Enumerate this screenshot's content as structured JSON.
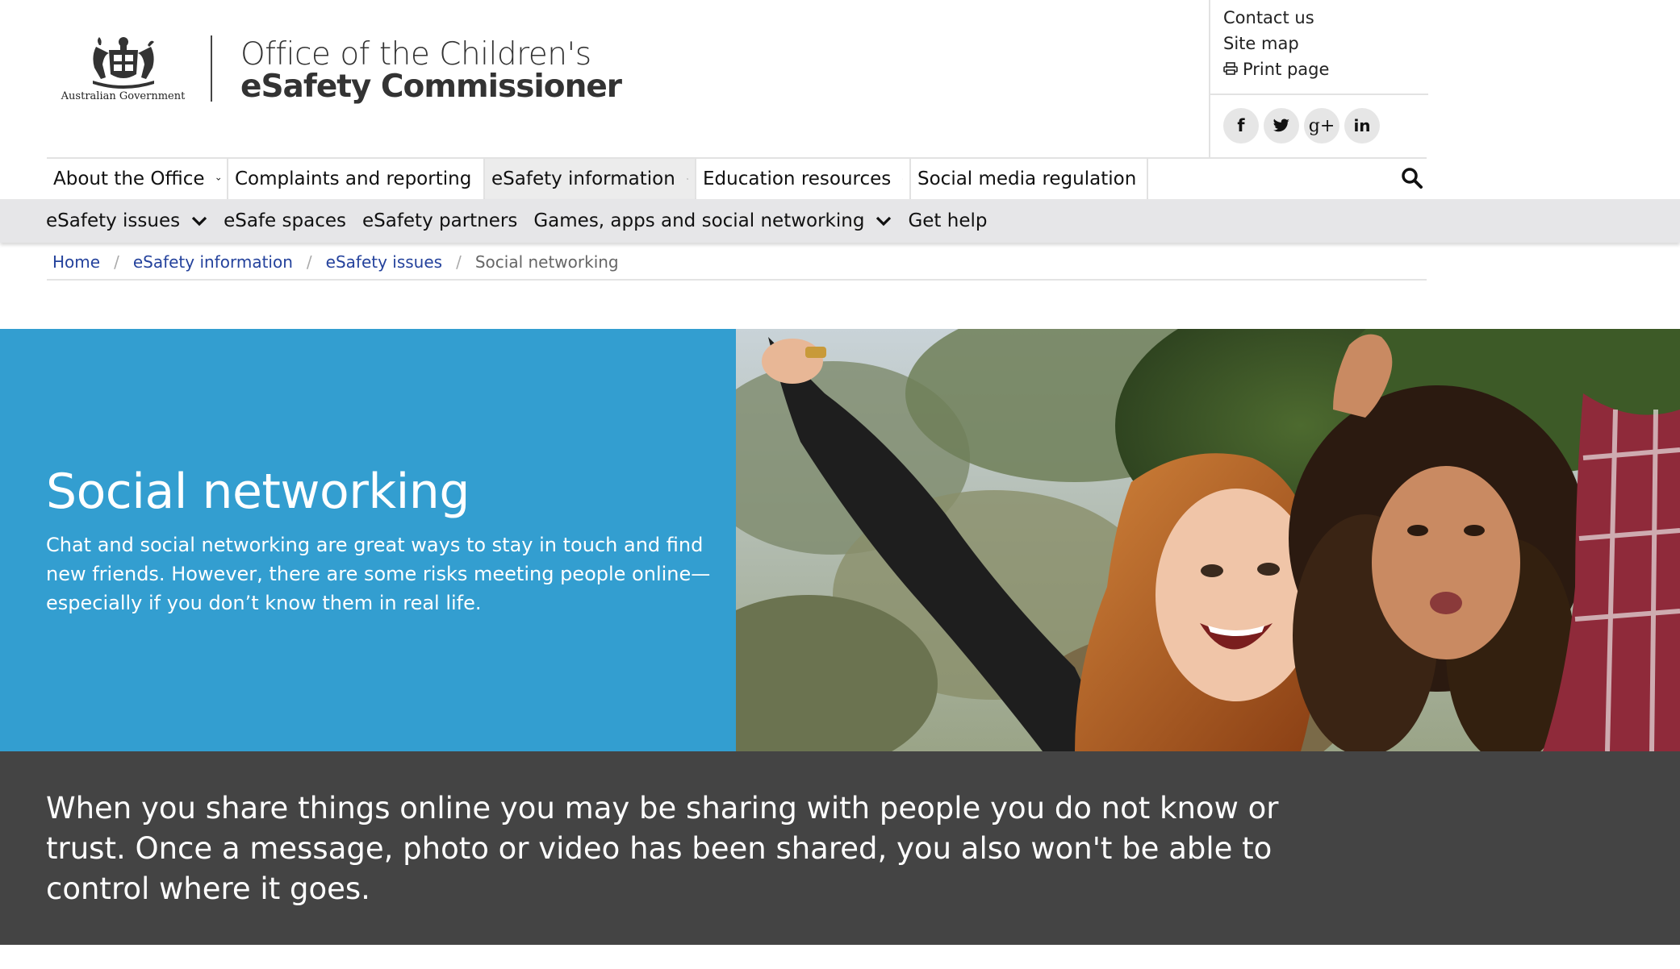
{
  "header": {
    "gov_label": "Australian Government",
    "org_line1": "Office of the Children's",
    "org_line2": "eSafety Commissioner"
  },
  "utility": {
    "contact": "Contact us",
    "sitemap": "Site map",
    "print": "Print page",
    "socials": [
      {
        "name": "facebook-icon",
        "glyph": "f"
      },
      {
        "name": "twitter-icon",
        "glyph": "t"
      },
      {
        "name": "google-plus-icon",
        "glyph": "g+"
      },
      {
        "name": "linkedin-icon",
        "glyph": "in"
      }
    ]
  },
  "main_nav": {
    "items": [
      {
        "label": "About the Office"
      },
      {
        "label": "Complaints and reporting"
      },
      {
        "label": "eSafety information"
      },
      {
        "label": "Education resources"
      },
      {
        "label": "Social media regulation"
      }
    ]
  },
  "sub_nav": {
    "items": [
      {
        "label": "eSafety issues"
      },
      {
        "label": "eSafe spaces"
      },
      {
        "label": "eSafety partners"
      },
      {
        "label": "Games, apps and social networking"
      },
      {
        "label": "Get help"
      }
    ]
  },
  "breadcrumb": {
    "items": [
      {
        "label": "Home"
      },
      {
        "label": "eSafety information"
      },
      {
        "label": "eSafety issues"
      },
      {
        "label": "Social networking"
      }
    ],
    "separator": "/"
  },
  "hero": {
    "title": "Social networking",
    "description": "Chat and social networking are great ways to stay in touch and find new friends. However, there are some risks meeting people online—especially if you don’t know them in real life."
  },
  "callout": {
    "text": "When you share things online you may be sharing with people you do not know or trust. Once a message, photo or video has been shared, you also won't be able to control where it goes."
  },
  "colors": {
    "hero_blue": "#339ed0",
    "callout_dark": "#444444",
    "link_blue": "#24429c",
    "subnav_grey": "#e6e6e8"
  }
}
